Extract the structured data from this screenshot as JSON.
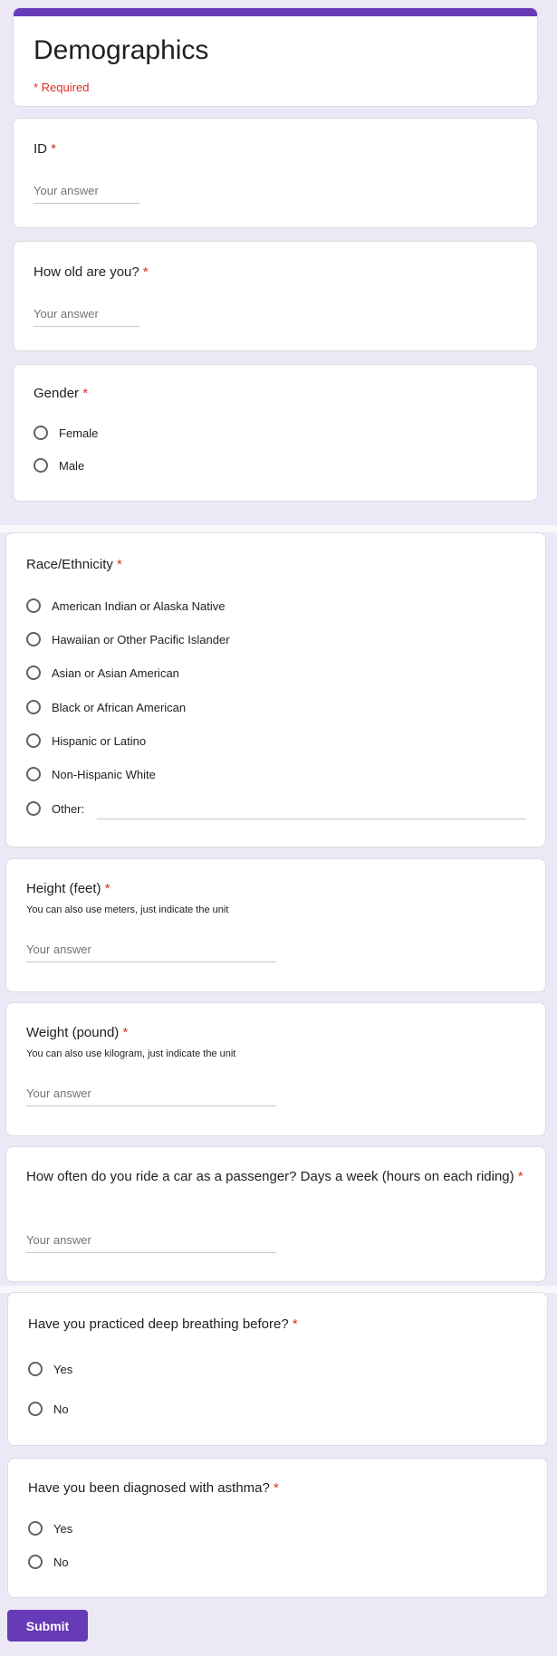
{
  "form": {
    "title": "Demographics",
    "required_note": "* Required",
    "star": "*"
  },
  "questions": {
    "id": {
      "title": "ID",
      "placeholder": "Your answer"
    },
    "age": {
      "title": "How old are you?",
      "placeholder": "Your answer"
    },
    "gender": {
      "title": "Gender",
      "options": [
        "Female",
        "Male"
      ]
    },
    "race": {
      "title": "Race/Ethnicity",
      "options": [
        "American Indian or Alaska Native",
        "Hawaiian or Other Pacific Islander",
        "Asian or Asian American",
        "Black or African American",
        "Hispanic or Latino",
        "Non-Hispanic White",
        "Other:"
      ]
    },
    "height": {
      "title": "Height (feet)",
      "help": "You can also use meters, just indicate the unit",
      "placeholder": "Your answer"
    },
    "weight": {
      "title": "Weight (pound)",
      "help": "You can also use kilogram, just indicate the unit",
      "placeholder": "Your answer"
    },
    "car": {
      "title": "How often do you ride a car as a passenger? Days a week (hours on each riding)",
      "placeholder": "Your answer"
    },
    "breathing": {
      "title": "Have you practiced deep breathing before?",
      "options": [
        "Yes",
        "No"
      ]
    },
    "asthma": {
      "title": "Have you been diagnosed with asthma?",
      "options": [
        "Yes",
        "No"
      ]
    }
  },
  "submit": {
    "label": "Submit"
  },
  "colors": {
    "accent": "#673ab7",
    "background": "#ece8f6",
    "required": "#d93025"
  }
}
